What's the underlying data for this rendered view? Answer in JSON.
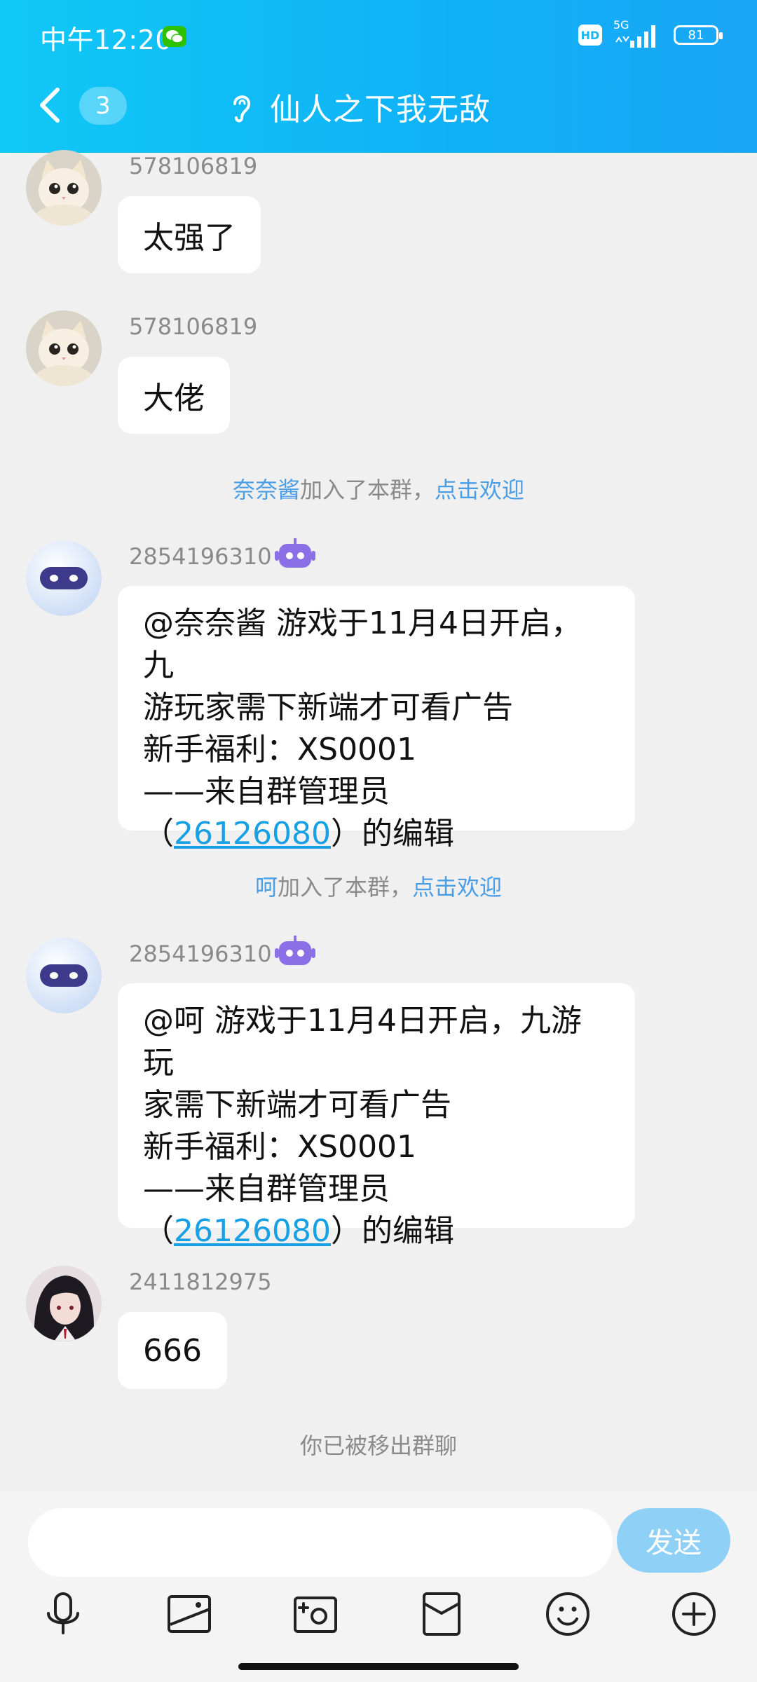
{
  "status_bar": {
    "time": "中午12:20",
    "network": "5G",
    "hd": "HD",
    "battery": "81"
  },
  "header": {
    "unread_count": "3",
    "title": "仙人之下我无敌"
  },
  "messages": [
    {
      "sender": "578106819",
      "text": "太强了",
      "avatar": "cat-avatar"
    },
    {
      "sender": "578106819",
      "text": "大佬",
      "avatar": "cat-avatar"
    },
    {
      "sender": "2854196310",
      "avatar": "robot-avatar",
      "lines": [
        "@奈奈酱 游戏于11月4日开启，九",
        "游玩家需下新端才可看广告",
        "新手福利：XS0001",
        "——来自群管理员"
      ],
      "paren_open": "（",
      "link": "26126080",
      "paren_close": "）的编辑"
    },
    {
      "sender": "2854196310",
      "avatar": "robot-avatar",
      "lines": [
        "@呵 游戏于11月4日开启，九游玩",
        "家需下新端才可看广告",
        "新手福利：XS0001",
        "——来自群管理员"
      ],
      "paren_open": "（",
      "link": "26126080",
      "paren_close": "）的编辑"
    },
    {
      "sender": "2411812975",
      "text": "666",
      "avatar": "anime-avatar"
    }
  ],
  "system_messages": [
    {
      "name": "奈奈酱",
      "middle": "加入了本群，",
      "action": "点击欢迎"
    },
    {
      "name": "呵",
      "middle": "加入了本群，",
      "action": "点击欢迎"
    },
    {
      "text": "你已被移出群聊"
    }
  ],
  "input": {
    "placeholder": "",
    "send_label": "发送"
  },
  "toolbar": [
    "mic-icon",
    "image-icon",
    "camera-icon",
    "red-packet-icon",
    "emoji-icon",
    "plus-icon"
  ],
  "colors": {
    "header": "#11c8f6",
    "link": "#17a0e3",
    "highlight": "#4a9ee6",
    "send_button": "#8fd0f7"
  }
}
